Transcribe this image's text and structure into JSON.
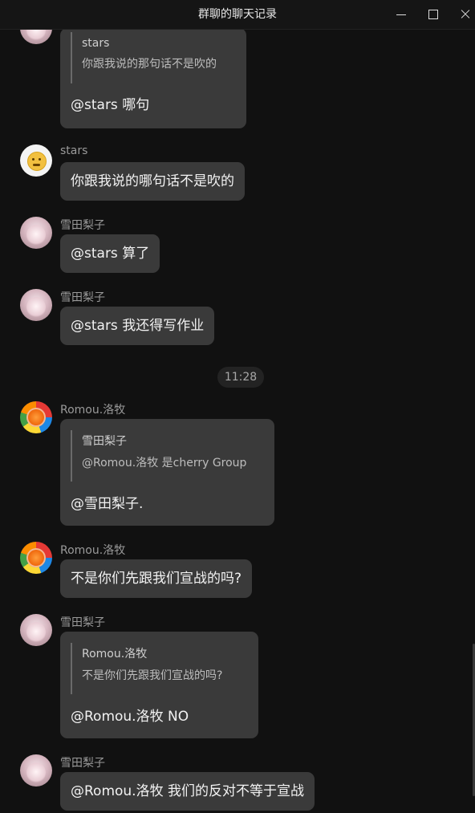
{
  "window": {
    "title": "群聊的聊天记录"
  },
  "time_divider": "11:28",
  "messages": [
    {
      "sender": "",
      "avatar": "yuki-avatar",
      "quote": {
        "name": "stars",
        "text": "你跟我说的那句话不是吹的"
      },
      "text": "@stars 哪句"
    },
    {
      "sender": "stars",
      "avatar": "thinking-emoji-avatar",
      "text": "你跟我说的哪句话不是吹的"
    },
    {
      "sender": "雪田梨子",
      "avatar": "yuki-avatar",
      "text": "@stars 算了"
    },
    {
      "sender": "雪田梨子",
      "avatar": "yuki-avatar",
      "text": "@stars 我还得写作业"
    },
    {
      "sender": "Romou.洛牧",
      "avatar": "romou-avatar",
      "quote": {
        "name": "雪田梨子",
        "text": "@Romou.洛牧 是cherry Group"
      },
      "text": "@雪田梨子."
    },
    {
      "sender": "Romou.洛牧",
      "avatar": "romou-avatar",
      "text": "不是你们先跟我们宣战的吗?"
    },
    {
      "sender": "雪田梨子",
      "avatar": "yuki-avatar",
      "quote": {
        "name": "Romou.洛牧",
        "text": "不是你们先跟我们宣战的吗?"
      },
      "text": "@Romou.洛牧 NO"
    },
    {
      "sender": "雪田梨子",
      "avatar": "yuki-avatar",
      "text": "@Romou.洛牧 我们的反对不等于宣战"
    }
  ],
  "colors": {
    "background": "#111111",
    "bubble": "#3a3a3a",
    "sender_name": "#9a9a9a"
  }
}
